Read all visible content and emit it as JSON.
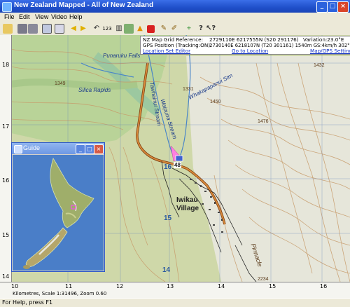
{
  "window": {
    "title": "New Zealand Mapped - All of New Zealand"
  },
  "menu": [
    "File",
    "Edit",
    "View",
    "Video",
    "Help"
  ],
  "toolbar": {
    "icons": [
      "open-icon",
      "print-icon",
      "print-preview-icon",
      "copy-icon",
      "cut-icon",
      "back-arrow-icon",
      "forward-arrow-icon",
      "undo-icon",
      "number-sequence-icon",
      "book-icon",
      "map-icon",
      "warning-icon",
      "record-stop-icon",
      "draw-tool-icon",
      "measure-tool-icon",
      "gps-icon",
      "help-icon",
      "context-help-icon"
    ],
    "number_label": "123"
  },
  "info": {
    "grid_label": "NZ Map Grid Reference:",
    "grid_value": "2729110E 6217555N (S20 291176)",
    "variation": "Variation:23.0°E",
    "gps_label": "GPS Position (Tracking:ON):",
    "gps_value": "2730140E 6218107N (T20 301161) 1540m GS:4km/h 302°M",
    "link_location_set": "Location Set Editor",
    "link_go": "Go to Location",
    "link_settings": "Map/GPS Settings"
  },
  "map_labels": {
    "falls": "Punaruku Falls",
    "rapids": "Silica Rapids",
    "waipuna_stream": "Waipuna Stream",
    "tawhainui_stream": "Tawhainui Stream",
    "whakapapanui_stm": "Whakapapanui Stm",
    "village_1": "Iwikau",
    "village_2": "Village",
    "pinnacle": "Pinnacle",
    "route_num": "48",
    "elev_1432": "1432",
    "elev_1349": "1349",
    "elev_1331": "1331",
    "elev_1450": "1450",
    "elev_1476": "1476",
    "elev_2234": "2234",
    "grid_16": "16",
    "grid_15": "15",
    "grid_14": "14"
  },
  "ruler_left": [
    "18",
    "17",
    "16",
    "15",
    "14"
  ],
  "ruler_bottom": [
    "10",
    "11",
    "12",
    "13",
    "14",
    "15",
    "16"
  ],
  "scale_text": "Kilometres, Scale 1:31496, Zoom 0.60",
  "status": "For Help, press F1",
  "guide": {
    "title": "Guide"
  }
}
